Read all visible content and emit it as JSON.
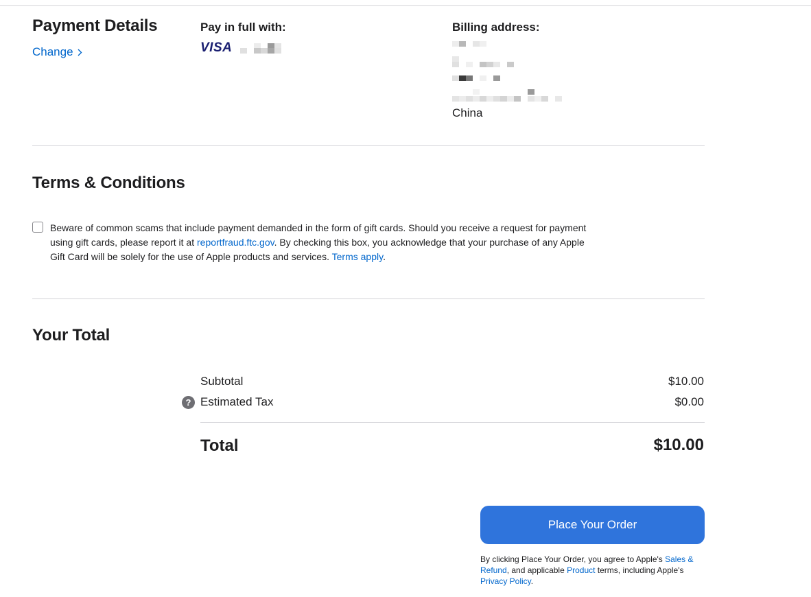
{
  "payment": {
    "title": "Payment Details",
    "change_label": "Change",
    "pay_label": "Pay in full with:",
    "card_brand": "VISA",
    "billing_label": "Billing address:",
    "country": "China"
  },
  "terms": {
    "title": "Terms & Conditions",
    "text_1": "Beware of common scams that include payment demanded in the form of gift cards. Should you receive a request for payment using gift cards, please report it at ",
    "link_1": "reportfraud.ftc.gov",
    "text_2": ". By checking this box, you acknowledge that your purchase of any Apple Gift Card will be solely for the use of Apple products and services. ",
    "link_2": "Terms apply",
    "text_3": "."
  },
  "total": {
    "title": "Your Total",
    "subtotal_label": "Subtotal",
    "subtotal_value": "$10.00",
    "tax_label": "Estimated Tax",
    "tax_value": "$0.00",
    "total_label": "Total",
    "total_value": "$10.00"
  },
  "order": {
    "button_label": "Place Your Order",
    "fine_1": "By clicking Place Your Order, you agree to Apple's ",
    "fine_link_1": "Sales & Refund",
    "fine_2": ", and applicable ",
    "fine_link_2": "Product",
    "fine_3": " terms, including Apple's ",
    "fine_link_3": "Privacy Policy",
    "fine_4": "."
  },
  "colors": {
    "accent_link": "#0066cc",
    "button_blue": "#2f74dc",
    "visa_blue": "#1a1f71"
  }
}
